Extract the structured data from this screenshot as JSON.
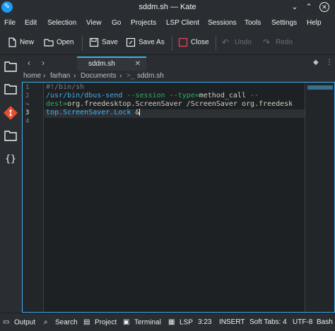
{
  "window": {
    "title": "sddm.sh — Kate"
  },
  "menu": [
    "File",
    "Edit",
    "Selection",
    "View",
    "Go",
    "Projects",
    "LSP Client",
    "Sessions",
    "Tools",
    "Settings",
    "Help"
  ],
  "toolbar": {
    "new": "New",
    "open": "Open",
    "save": "Save",
    "save_as": "Save As",
    "close": "Close",
    "undo": "Undo",
    "redo": "Redo"
  },
  "tab": {
    "label": "sddm.sh"
  },
  "breadcrumb": [
    "home",
    "farhan",
    "Documents",
    "sddm.sh"
  ],
  "editor": {
    "line_numbers": [
      "1",
      "2",
      "↪",
      "3",
      "4"
    ],
    "lines": {
      "l1": "#!/bin/sh",
      "l2_cmd": "/usr/bin/dbus-send",
      "l2_opt1": " --session --type=",
      "l2_txt1": "method_call",
      "l2_opt2": " --",
      "l3_opt": "dest=",
      "l3_txt": "org.freedesktop.ScreenSaver /ScreenSaver org.freedesk",
      "l4_cmd": "top.ScreenSaver.Lock",
      "l4_txt": " &"
    }
  },
  "status": {
    "output": "Output",
    "search": "Search",
    "project": "Project",
    "terminal": "Terminal",
    "lsp": "LSP",
    "cursor": "3:23",
    "mode": "INSERT",
    "tabs": "Soft Tabs: 4",
    "encoding": "UTF-8",
    "language": "Bash"
  },
  "colors": {
    "accent": "#3daee9",
    "background": "#232629"
  }
}
